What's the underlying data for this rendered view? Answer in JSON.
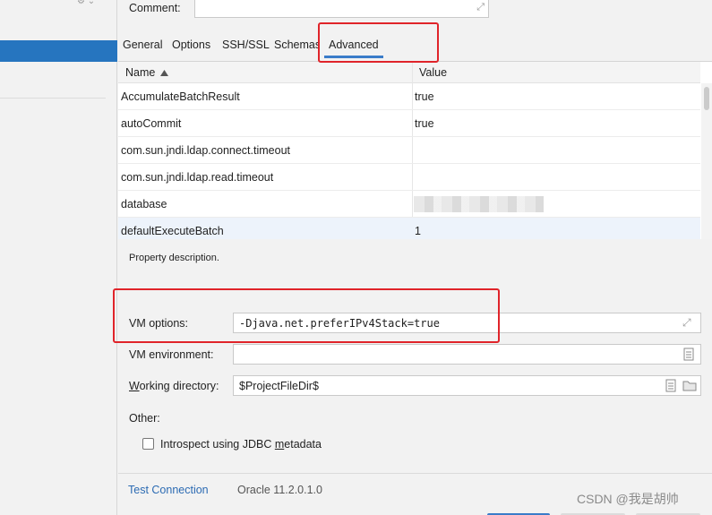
{
  "comment": {
    "label": "Comment:",
    "value": ""
  },
  "tabs": [
    {
      "label": "General"
    },
    {
      "label": "Options"
    },
    {
      "label": "SSH/SSL"
    },
    {
      "label": "Schemas"
    },
    {
      "label": "Advanced"
    }
  ],
  "active_tab": "Advanced",
  "table": {
    "headers": {
      "name": "Name",
      "value": "Value"
    },
    "sort_icon": "sort-ascending-icon",
    "rows": [
      {
        "name": "AccumulateBatchResult",
        "value": "true"
      },
      {
        "name": "autoCommit",
        "value": "true"
      },
      {
        "name": "com.sun.jndi.ldap.connect.timeout",
        "value": ""
      },
      {
        "name": "com.sun.jndi.ldap.read.timeout",
        "value": ""
      },
      {
        "name": "database",
        "value": ""
      },
      {
        "name": "defaultExecuteBatch",
        "value": "1"
      }
    ]
  },
  "property_description": "Property description.",
  "vm_options": {
    "label": "VM options:",
    "value": "-Djava.net.preferIPv4Stack=true"
  },
  "vm_environment": {
    "label": "VM environment:",
    "value": ""
  },
  "working_directory": {
    "label": "Working directory:",
    "value": "$ProjectFileDir$"
  },
  "other": {
    "label": "Other:"
  },
  "introspect": {
    "label": "Introspect using JDBC metadata",
    "checked": false
  },
  "footer": {
    "test_connection": "Test Connection",
    "driver_version": "Oracle 11.2.0.1.0"
  },
  "watermark": "CSDN @我是胡帅",
  "colors": {
    "accent": "#2675bf",
    "link": "#2c6bb3",
    "highlight": "#e0242a"
  }
}
